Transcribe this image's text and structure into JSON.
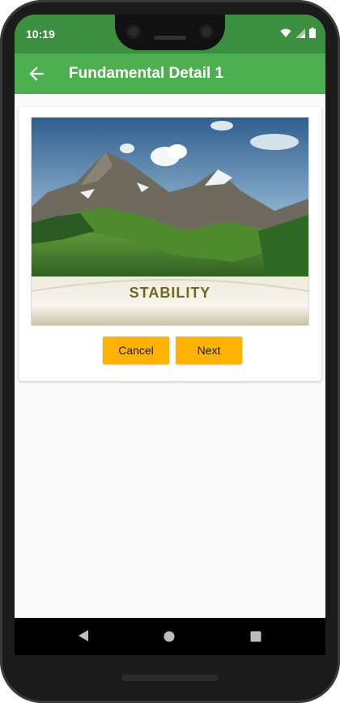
{
  "status_bar": {
    "time": "10:19",
    "icons": [
      "wifi-icon",
      "signal-icon",
      "battery-icon"
    ],
    "color": "#3b8f3e"
  },
  "app_bar": {
    "title": "Fundamental Detail 1",
    "back_icon": "arrow-back-icon",
    "color": "#4caf50"
  },
  "card": {
    "banner": {
      "label": "STABILITY",
      "image": "mountain landscape"
    },
    "buttons": {
      "cancel_label": "Cancel",
      "next_label": "Next",
      "color": "#ffb300"
    }
  },
  "nav_bar": {
    "icons": [
      "back-triangle-icon",
      "home-circle-icon",
      "recents-square-icon"
    ]
  }
}
